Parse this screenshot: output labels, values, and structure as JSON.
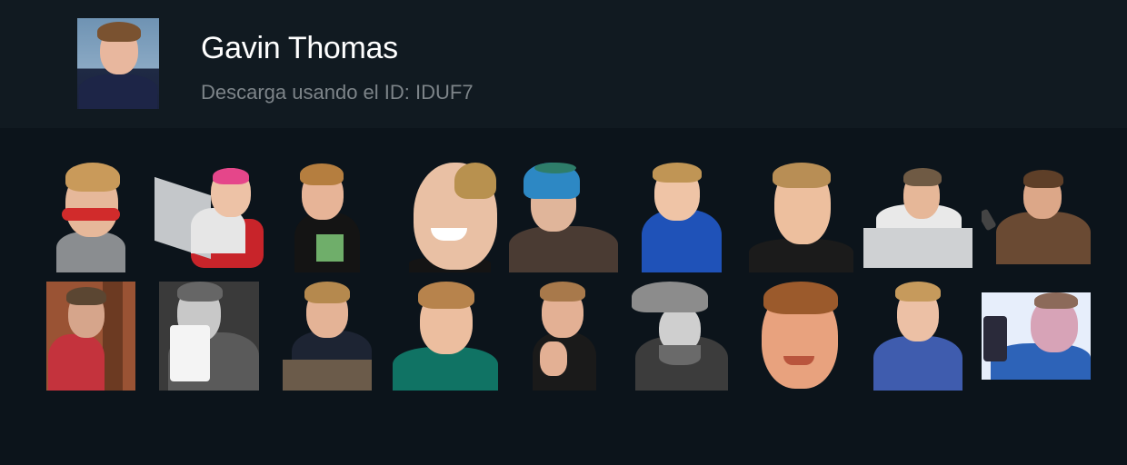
{
  "pack": {
    "title": "Gavin Thomas",
    "subtitle": "Descarga usando el ID: IDUF7"
  },
  "stickers": [
    {
      "label": "sunglasses"
    },
    {
      "label": "laptop-red-chair"
    },
    {
      "label": "black-tshirt"
    },
    {
      "label": "big-smile"
    },
    {
      "label": "blue-hat-jacket"
    },
    {
      "label": "blue-shirt"
    },
    {
      "label": "smirk"
    },
    {
      "label": "desk-thinking"
    },
    {
      "label": "phone-camo"
    },
    {
      "label": "peeking-door"
    },
    {
      "label": "coffee-bw"
    },
    {
      "label": "leaning-table"
    },
    {
      "label": "green-shirt"
    },
    {
      "label": "hands-praying"
    },
    {
      "label": "cowboy-bw"
    },
    {
      "label": "face-closeup"
    },
    {
      "label": "blue-tshirt"
    },
    {
      "label": "sleeping-tablet"
    }
  ]
}
